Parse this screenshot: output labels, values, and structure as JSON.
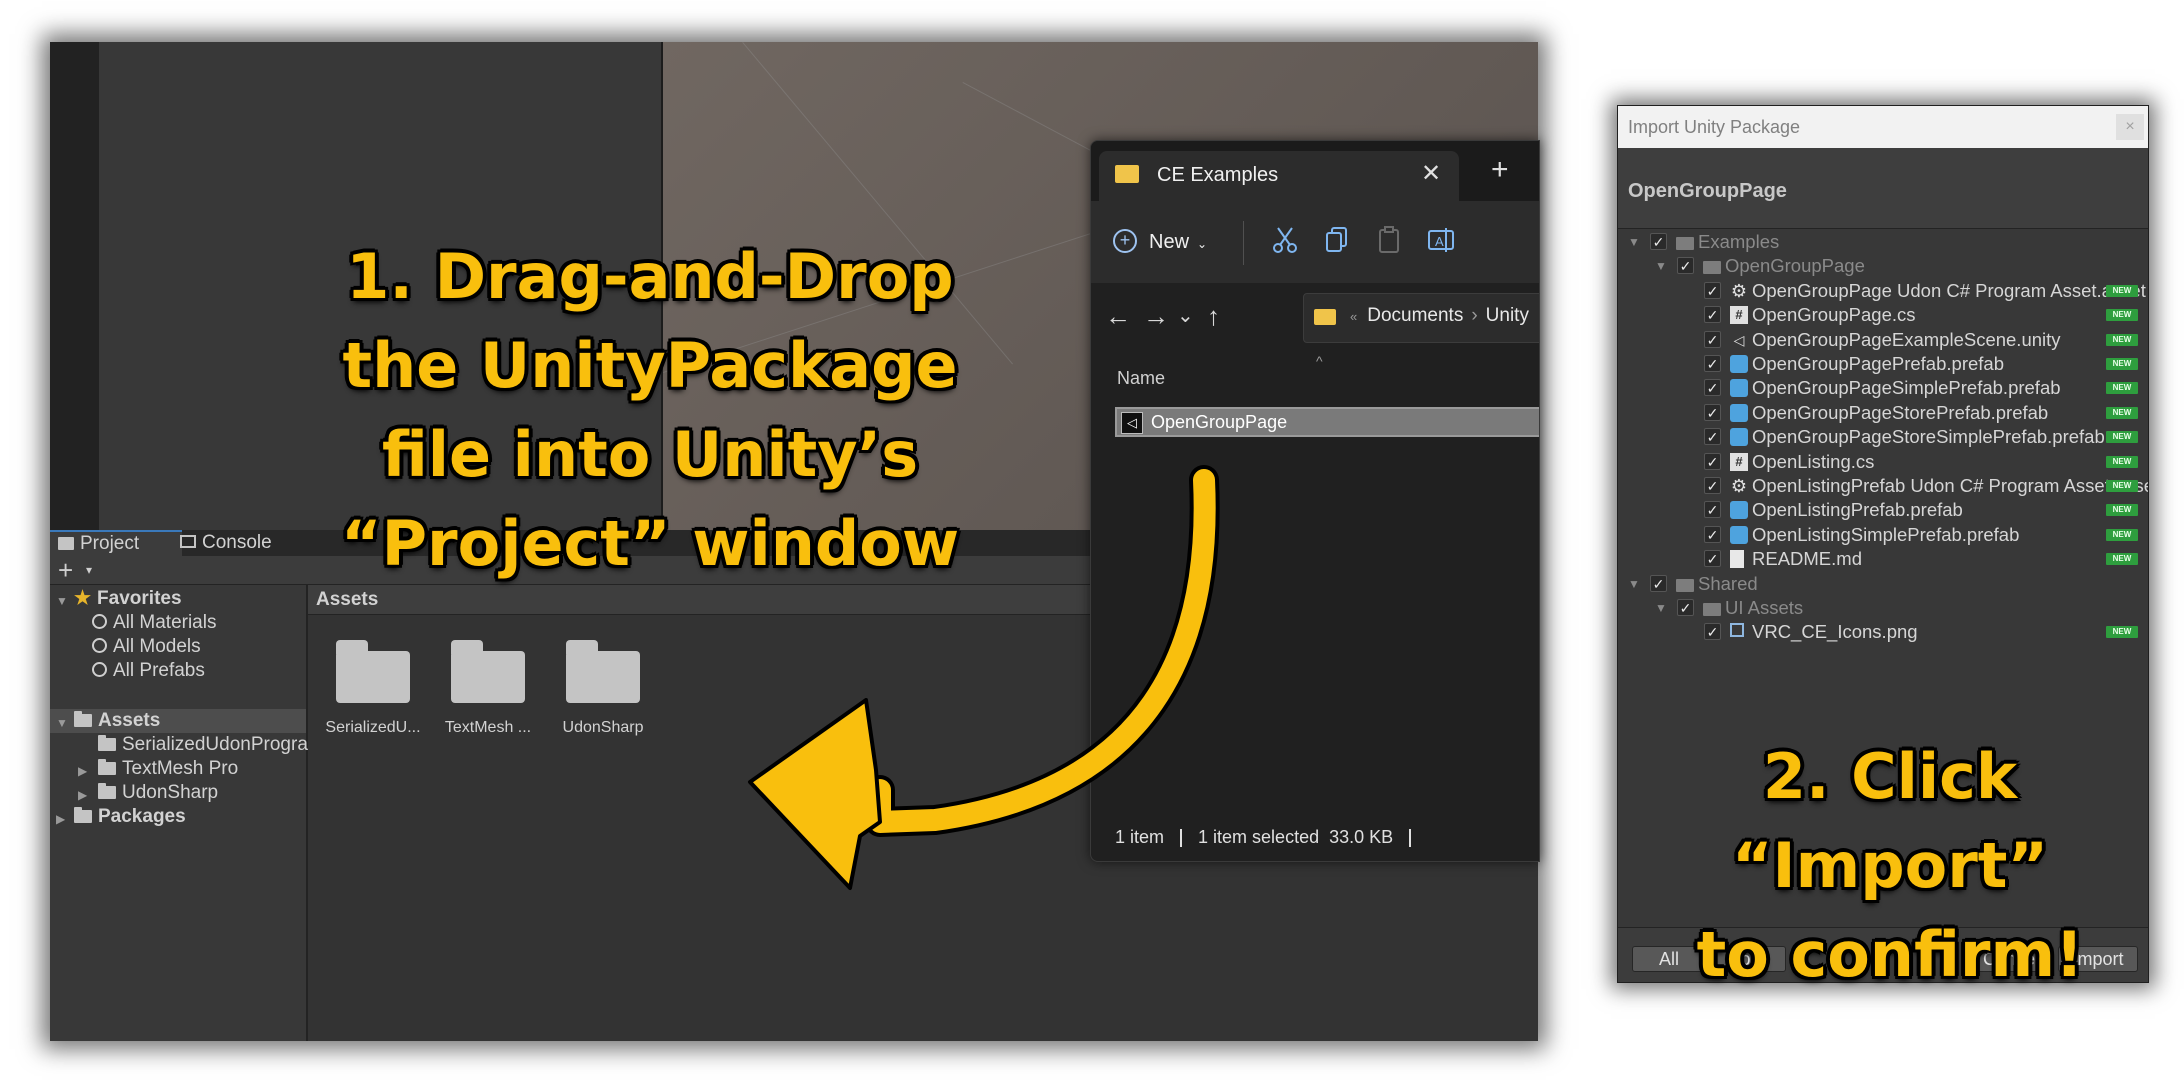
{
  "unity": {
    "tabs": [
      {
        "label": "Project",
        "icon": "folder-icon"
      },
      {
        "label": "Console",
        "icon": "console-icon"
      }
    ],
    "toolbar": {
      "add_label": "+",
      "add_caret": "▾"
    },
    "tree": {
      "favorites": "Favorites",
      "all_materials": "All Materials",
      "all_models": "All Models",
      "all_prefabs": "All Prefabs",
      "assets": "Assets",
      "serialized": "SerializedUdonProgra",
      "textmesh": "TextMesh Pro",
      "udonsharp": "UdonSharp",
      "packages": "Packages"
    },
    "grid": {
      "header": "Assets",
      "items": [
        "SerializedU...",
        "TextMesh ...",
        "UdonSharp"
      ]
    }
  },
  "explorer": {
    "tab_title": "CE Examples",
    "close": "✕",
    "new_tab": "+",
    "new_label": "New",
    "new_icon": "+",
    "new_caret": "⌄",
    "nav_back": "←",
    "nav_forward": "→",
    "nav_recent": "⌄",
    "nav_up": "↑",
    "address_prefix": "«",
    "address_documents": "Documents",
    "address_sep": "›",
    "address_unity": "Unity",
    "column_name": "Name",
    "sort_caret": "^",
    "file_name": "OpenGroupPage",
    "status_count": "1 item",
    "status_selected": "1 item selected",
    "status_size": "33.0 KB"
  },
  "import_dialog": {
    "window_title": "Import Unity Package",
    "close": "×",
    "package_name": "OpenGroupPage",
    "new_badge": "NEW",
    "items": [
      {
        "name": "Examples",
        "icon": "folder-icon"
      },
      {
        "name": "OpenGroupPage",
        "icon": "folder-icon"
      },
      {
        "name": "OpenGroupPage Udon C# Program Asset.asset",
        "icon": "gear-icon"
      },
      {
        "name": "OpenGroupPage.cs",
        "icon": "csharp-script-icon"
      },
      {
        "name": "OpenGroupPageExampleScene.unity",
        "icon": "unity-scene-icon"
      },
      {
        "name": "OpenGroupPagePrefab.prefab",
        "icon": "prefab-icon"
      },
      {
        "name": "OpenGroupPageSimplePrefab.prefab",
        "icon": "prefab-icon"
      },
      {
        "name": "OpenGroupPageStorePrefab.prefab",
        "icon": "prefab-icon"
      },
      {
        "name": "OpenGroupPageStoreSimplePrefab.prefab",
        "icon": "prefab-icon"
      },
      {
        "name": "OpenListing.cs",
        "icon": "csharp-script-icon"
      },
      {
        "name": "OpenListingPrefab Udon C# Program Asset.asset",
        "icon": "gear-icon"
      },
      {
        "name": "OpenListingPrefab.prefab",
        "icon": "prefab-icon"
      },
      {
        "name": "OpenListingSimplePrefab.prefab",
        "icon": "prefab-icon"
      },
      {
        "name": "README.md",
        "icon": "document-icon"
      },
      {
        "name": "Shared",
        "icon": "folder-icon"
      },
      {
        "name": "UI Assets",
        "icon": "folder-icon"
      },
      {
        "name": "VRC_CE_Icons.png",
        "icon": "image-icon"
      }
    ],
    "buttons": {
      "all": "All",
      "none": "None",
      "cancel": "Cancel",
      "import": "Import"
    }
  },
  "instructions": {
    "step1": [
      "1. Drag-and-Drop",
      "the UnityPackage",
      "file into Unity’s",
      "“Project” window"
    ],
    "step2": [
      "2. Click “Import”",
      "to confirm!"
    ]
  },
  "colors": {
    "accent_yellow": "#f9bf0d",
    "new_badge_green": "#2e9e3e",
    "prefab_blue": "#4ea3de",
    "folder_yellow": "#f0c44a"
  }
}
